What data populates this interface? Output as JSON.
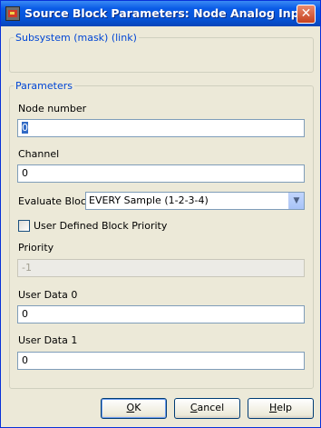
{
  "window": {
    "title": "Source Block Parameters: Node Analog Input",
    "close_glyph": "✕"
  },
  "groups": {
    "subsystem_label": "Subsystem (mask) (link)",
    "parameters_label": "Parameters"
  },
  "fields": {
    "node_number": {
      "label": "Node number",
      "value": "0"
    },
    "channel": {
      "label": "Channel",
      "value": "0"
    },
    "evaluate_block": {
      "label": "Evaluate Block",
      "selected": "EVERY Sample (1-2-3-4)"
    },
    "user_priority": {
      "label": "User Defined Block Priority",
      "checked": false
    },
    "priority": {
      "label": "Priority",
      "value": "-1",
      "disabled": true
    },
    "user_data_0": {
      "label": "User Data 0",
      "value": "0"
    },
    "user_data_1": {
      "label": "User Data 1",
      "value": "0"
    }
  },
  "buttons": {
    "ok": {
      "mnemonic": "O",
      "rest": "K"
    },
    "cancel": {
      "mnemonic": "C",
      "rest": "ancel"
    },
    "help": {
      "mnemonic": "H",
      "rest": "elp"
    }
  },
  "colors": {
    "titlebar": "#0a5be6",
    "group_label": "#0046d5",
    "selection": "#316ac5"
  }
}
